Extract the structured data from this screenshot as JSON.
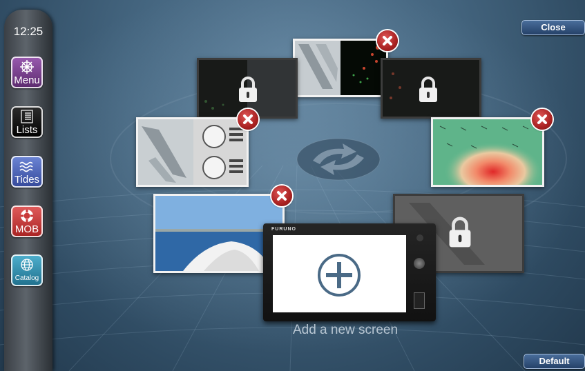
{
  "sidebar": {
    "clock": "12:25",
    "buttons": [
      {
        "label": "Menu",
        "icon": "helm-wheel-icon",
        "color": "#7b3f8f"
      },
      {
        "label": "Lists",
        "icon": "list-icon",
        "color": "#111111"
      },
      {
        "label": "Tides",
        "icon": "waves-icon",
        "color": "#4a64b8"
      },
      {
        "label": "MOB",
        "icon": "lifebuoy-icon",
        "color": "#c93a3a"
      },
      {
        "label": "Catalog",
        "icon": "globe-icon",
        "color": "#2f8aa8"
      }
    ]
  },
  "top_right": {
    "close_label": "Close"
  },
  "bottom_right": {
    "default_label": "Default"
  },
  "carousel": {
    "center_icon": "rotate-arrows-icon",
    "add_screen_label": "Add a new screen",
    "device_brand": "FURUNO",
    "add_icon": "plus-circle-icon",
    "screens": [
      {
        "id": "chart-radar",
        "content": "chart-radar-split",
        "removable": true,
        "locked": false
      },
      {
        "id": "radar-locked-left",
        "content": "radar",
        "removable": false,
        "locked": true
      },
      {
        "id": "radar-locked-right",
        "content": "radar",
        "removable": false,
        "locked": true
      },
      {
        "id": "chart-gauges",
        "content": "chart-gauges-split",
        "removable": true,
        "locked": false
      },
      {
        "id": "weather",
        "content": "weather-map",
        "removable": true,
        "locked": false
      },
      {
        "id": "camera",
        "content": "camera-view",
        "removable": true,
        "locked": false
      },
      {
        "id": "chart-locked",
        "content": "chart",
        "removable": false,
        "locked": true
      }
    ]
  },
  "colors": {
    "accent_button": "#233f66",
    "close_x": "#a22222"
  }
}
